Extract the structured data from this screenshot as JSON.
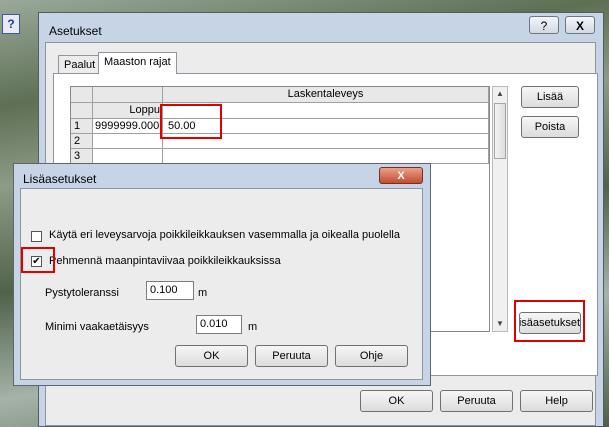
{
  "background": {
    "help_glyph": "?"
  },
  "dialog": {
    "title": "Asetukset",
    "help_btn": "?",
    "close_btn": "X",
    "tabs": [
      {
        "label": "Paalut"
      },
      {
        "label": "Maaston rajat"
      }
    ],
    "table": {
      "header_group": "Laskentaleveys",
      "col_loppu": "Loppu",
      "rows": [
        {
          "num": "1",
          "loppu": "9999999.000",
          "value": "50.00"
        },
        {
          "num": "2",
          "loppu": "",
          "value": ""
        },
        {
          "num": "3",
          "loppu": "",
          "value": ""
        }
      ]
    },
    "buttons": {
      "add": "Lisää",
      "remove": "Poista",
      "advanced": "Lisäasetukset",
      "ok": "OK",
      "cancel": "Peruuta",
      "help": "Help"
    }
  },
  "subdialog": {
    "title": "Lisäasetukset",
    "close_glyph": "X",
    "option1": {
      "label": "Käytä eri leveysarvoja poikkileikkauksen vasemmalla ja oikealla puolella",
      "checked": false
    },
    "option2": {
      "label": "Pehmennä maanpintaviivaa poikkileikkauksissa",
      "checked": true,
      "mark": "✔"
    },
    "vertical_tolerance": {
      "label": "Pystytoleranssi",
      "value": "0.100",
      "unit": "m"
    },
    "min_horizontal": {
      "label": "Minimi vaakaetäisyys",
      "value": "0.010",
      "unit": "m"
    },
    "buttons": {
      "ok": "OK",
      "cancel": "Peruuta",
      "help": "Ohje"
    }
  }
}
